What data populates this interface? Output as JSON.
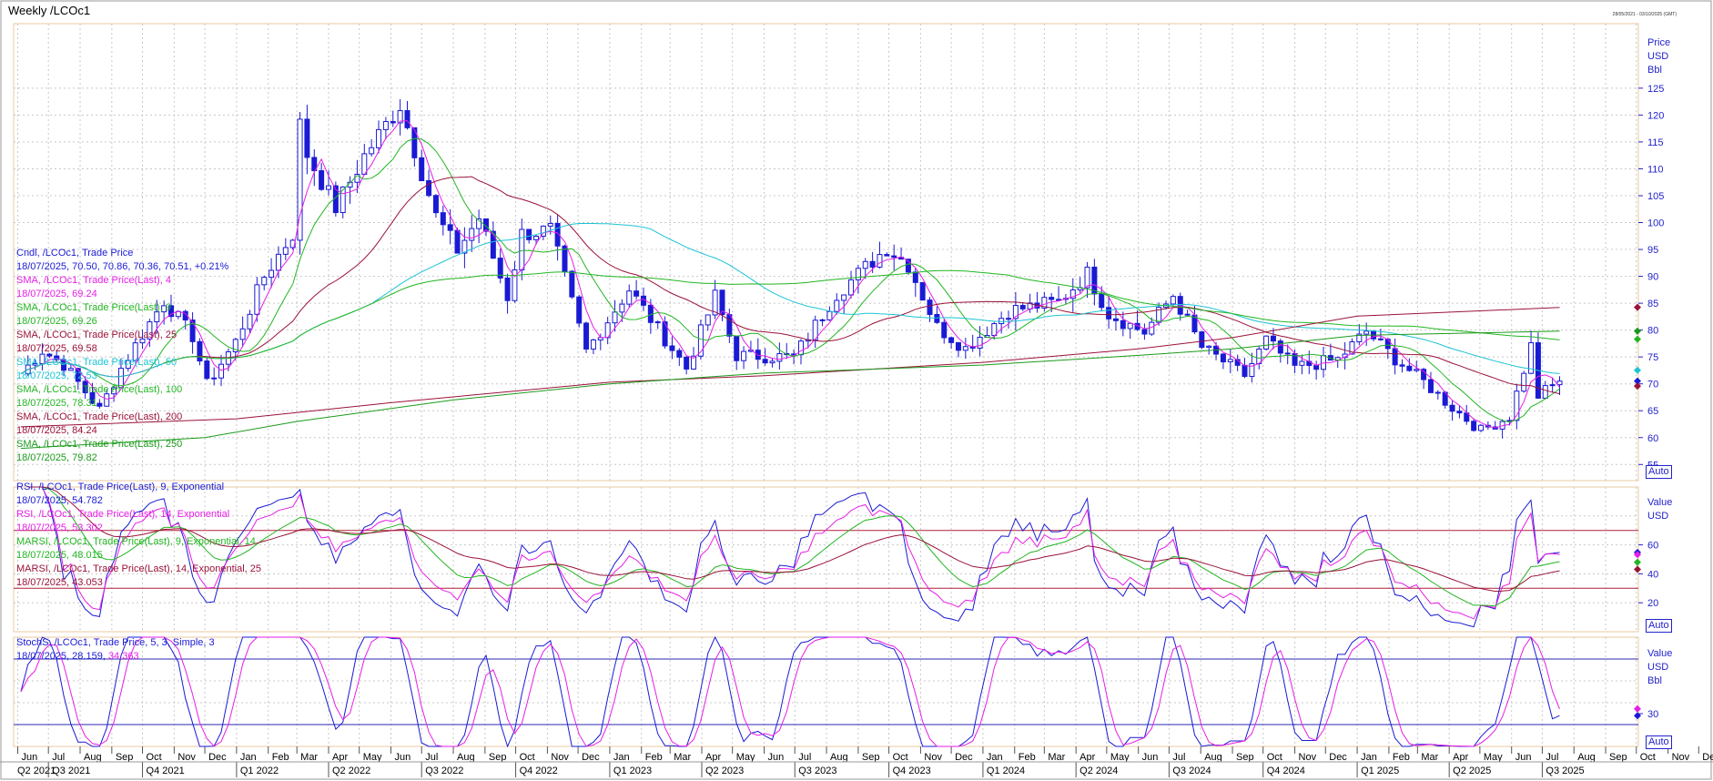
{
  "header": {
    "title": "Weekly /LCOc1",
    "range_text": "28/05/2021 - 03/10/2025 (GMT)"
  },
  "panels": {
    "price": {
      "unit_lines": [
        "Price",
        "USD",
        "Bbl"
      ],
      "ticks": [
        "55",
        "60",
        "65",
        "70",
        "75",
        "80",
        "85",
        "90",
        "95",
        "100",
        "105",
        "110",
        "115",
        "120",
        "125"
      ],
      "auto_label": "Auto",
      "legend": [
        {
          "label": "Cndl, /LCOc1, Trade Price",
          "value": "18/07/2025, 70.50, 70.86, 70.36, 70.51, +0.21%",
          "color": "#1a1ad4"
        },
        {
          "label": "SMA, /LCOc1, Trade Price(Last),  4",
          "value": "18/07/2025, 69.24",
          "color": "#e61ee6"
        },
        {
          "label": "SMA, /LCOc1, Trade Price(Last),  9",
          "value": "18/07/2025, 69.26",
          "color": "#22b522"
        },
        {
          "label": "SMA, /LCOc1, Trade Price(Last),  25",
          "value": "18/07/2025, 69.58",
          "color": "#9a1238"
        },
        {
          "label": "SMA, /LCOc1, Trade Price(Last),  50",
          "value": "18/07/2025, 72.53",
          "color": "#1cc4d4"
        },
        {
          "label": "SMA, /LCOc1, Trade Price(Last),  100",
          "value": "18/07/2025, 78.31",
          "color": "#22b522"
        },
        {
          "label": "SMA, /LCOc1, Trade Price(Last),  200",
          "value": "18/07/2025, 84.24",
          "color": "#9a1238"
        },
        {
          "label": "SMA, /LCOc1, Trade Price(Last),  250",
          "value": "18/07/2025, 79.82",
          "color": "#1a9a1a"
        }
      ]
    },
    "rsi": {
      "unit_lines": [
        "Value",
        "USD"
      ],
      "ticks": [
        "20",
        "40",
        "60"
      ],
      "auto_label": "Auto",
      "legend": [
        {
          "label": "RSI, /LCOc1, Trade Price(Last),  9, Exponential",
          "value": "18/07/2025, 54.782",
          "color": "#1a1ad4"
        },
        {
          "label": "RSI, /LCOc1, Trade Price(Last),  14, Exponential",
          "value": "18/07/2025, 53.302",
          "color": "#e61ee6"
        },
        {
          "label": "MARSI, /LCOc1, Trade Price(Last),  9, Exponential, 14",
          "value": "18/07/2025, 48.015",
          "color": "#22b522"
        },
        {
          "label": "MARSI, /LCOc1, Trade Price(Last),  14, Exponential, 25",
          "value": "18/07/2025, 43.053",
          "color": "#9a1238"
        }
      ]
    },
    "stoch": {
      "unit_lines": [
        "Value",
        "USD",
        "Bbl"
      ],
      "ticks": [
        "30"
      ],
      "auto_label": "Auto",
      "legend_label": "StochS, /LCOc1, Trade Price,  5, 3, Simple, 3",
      "legend_value_a": "18/07/2025, 28.159,",
      "legend_value_b": "34.363"
    }
  },
  "x_axis": {
    "months": [
      "Jun",
      "Jul",
      "Aug",
      "Sep",
      "Oct",
      "Nov",
      "Dec",
      "Jan",
      "Feb",
      "Mar",
      "Apr",
      "May",
      "Jun",
      "Jul",
      "Aug",
      "Sep",
      "Oct",
      "Nov",
      "Dec",
      "Jan",
      "Feb",
      "Mar",
      "Apr",
      "May",
      "Jun",
      "Jul",
      "Aug",
      "Sep",
      "Oct",
      "Nov",
      "Dec",
      "Jan",
      "Feb",
      "Mar",
      "Apr",
      "May",
      "Jun",
      "Jul",
      "Aug",
      "Sep",
      "Oct",
      "Nov",
      "Dec",
      "Jan",
      "Feb",
      "Mar",
      "Apr",
      "May",
      "Jun",
      "Jul",
      "Aug",
      "Sep",
      "Oct",
      "Nov",
      "Dec",
      "Jan",
      "Feb",
      "Mar",
      "Apr",
      "May",
      "Jun",
      "Jul",
      "Aug",
      "Sep"
    ],
    "quarters": [
      "Q2 2021",
      "Q3 2021",
      "Q4 2021",
      "Q1 2022",
      "Q2 2022",
      "Q3 2022",
      "Q4 2022",
      "Q1 2023",
      "Q2 2023",
      "Q3 2023",
      "Q4 2023",
      "Q1 2024",
      "Q2 2024",
      "Q3 2024",
      "Q4 2024",
      "Q1 2025",
      "Q2 2025",
      "Q3 2025"
    ]
  },
  "chart_data": {
    "type": "line",
    "title": "Weekly /LCOc1",
    "x_range": [
      "2021-05-28",
      "2025-10-03"
    ],
    "ylim_price": [
      52,
      137
    ],
    "ylim_osc": [
      0,
      100
    ],
    "colors": {
      "candle": "#1a1ad4",
      "sma4": "#e61ee6",
      "sma9": "#22b522",
      "sma25": "#9a1238",
      "sma50": "#1cc4d4",
      "sma100": "#22b522",
      "sma200": "#9a1238",
      "sma250": "#1a9a1a",
      "rsi9": "#1a1ad4",
      "rsi14": "#e61ee6",
      "marsi9": "#22b522",
      "marsi14": "#9a1238",
      "stoch_k": "#1a1ad4",
      "stoch_d": "#e61ee6"
    },
    "price_close_anchors": [
      [
        "2021-06-04",
        71.9
      ],
      [
        "2021-06-25",
        76.2
      ],
      [
        "2021-07-16",
        73.6
      ],
      [
        "2021-08-20",
        65.2
      ],
      [
        "2021-09-10",
        72.9
      ],
      [
        "2021-10-01",
        79.3
      ],
      [
        "2021-10-22",
        85.5
      ],
      [
        "2021-11-19",
        78.9
      ],
      [
        "2021-12-03",
        69.9
      ],
      [
        "2021-12-31",
        77.8
      ],
      [
        "2022-01-28",
        90.0
      ],
      [
        "2022-02-25",
        97.9
      ],
      [
        "2022-03-04",
        118.1
      ],
      [
        "2022-03-11",
        112.7
      ],
      [
        "2022-04-08",
        102.8
      ],
      [
        "2022-05-06",
        112.4
      ],
      [
        "2022-06-10",
        122.0
      ],
      [
        "2022-07-15",
        101.2
      ],
      [
        "2022-08-05",
        94.9
      ],
      [
        "2022-08-26",
        100.9
      ],
      [
        "2022-09-23",
        86.2
      ],
      [
        "2022-10-07",
        97.9
      ],
      [
        "2022-11-04",
        98.6
      ],
      [
        "2022-12-09",
        76.1
      ],
      [
        "2023-01-20",
        87.6
      ],
      [
        "2023-03-17",
        72.9
      ],
      [
        "2023-04-14",
        86.3
      ],
      [
        "2023-05-05",
        75.3
      ],
      [
        "2023-06-30",
        75.0
      ],
      [
        "2023-08-11",
        86.8
      ],
      [
        "2023-09-29",
        95.3
      ],
      [
        "2023-10-20",
        92.2
      ],
      [
        "2023-11-17",
        80.6
      ],
      [
        "2023-12-15",
        76.6
      ],
      [
        "2024-01-26",
        83.6
      ],
      [
        "2024-03-15",
        85.3
      ],
      [
        "2024-04-12",
        90.5
      ],
      [
        "2024-05-03",
        83.0
      ],
      [
        "2024-06-07",
        79.6
      ],
      [
        "2024-07-05",
        86.5
      ],
      [
        "2024-08-02",
        76.8
      ],
      [
        "2024-09-13",
        71.6
      ],
      [
        "2024-10-04",
        78.1
      ],
      [
        "2024-11-01",
        73.1
      ],
      [
        "2024-12-13",
        74.5
      ],
      [
        "2025-01-10",
        79.8
      ],
      [
        "2025-02-07",
        74.7
      ],
      [
        "2025-03-07",
        70.4
      ],
      [
        "2025-04-04",
        65.6
      ],
      [
        "2025-05-02",
        61.3
      ],
      [
        "2025-05-30",
        63.9
      ],
      [
        "2025-06-20",
        77.0
      ],
      [
        "2025-06-27",
        67.8
      ],
      [
        "2025-07-18",
        70.5
      ]
    ],
    "sma200_anchors": [
      [
        "2021-06-04",
        62.0
      ],
      [
        "2022-01-01",
        63.5
      ],
      [
        "2022-06-01",
        66.5
      ],
      [
        "2023-01-01",
        70.3
      ],
      [
        "2023-06-01",
        71.5
      ],
      [
        "2024-01-01",
        74.0
      ],
      [
        "2024-06-01",
        76.5
      ],
      [
        "2024-09-01",
        78.6
      ],
      [
        "2025-01-01",
        82.6
      ],
      [
        "2025-07-18",
        84.2
      ]
    ],
    "sma250_anchors": [
      [
        "2021-06-04",
        58.0
      ],
      [
        "2021-12-01",
        60.0
      ],
      [
        "2022-03-01",
        63.0
      ],
      [
        "2022-08-01",
        67.0
      ],
      [
        "2023-01-01",
        70.0
      ],
      [
        "2023-06-01",
        72.0
      ],
      [
        "2024-01-01",
        73.5
      ],
      [
        "2024-06-01",
        75.3
      ],
      [
        "2024-09-01",
        76.5
      ],
      [
        "2025-01-01",
        79.0
      ],
      [
        "2025-07-18",
        79.8
      ]
    ],
    "last_values": {
      "close": 70.51,
      "open": 70.5,
      "high": 70.86,
      "low": 70.36,
      "change_pct": "+0.21%",
      "sma4": 69.24,
      "sma9": 69.26,
      "sma25": 69.58,
      "sma50": 72.53,
      "sma100": 78.31,
      "sma200": 84.24,
      "sma250": 79.82,
      "rsi9": 54.782,
      "rsi14": 53.302,
      "marsi9": 48.015,
      "marsi14": 43.053,
      "stoch_k": 28.159,
      "stoch_d": 34.363
    }
  }
}
